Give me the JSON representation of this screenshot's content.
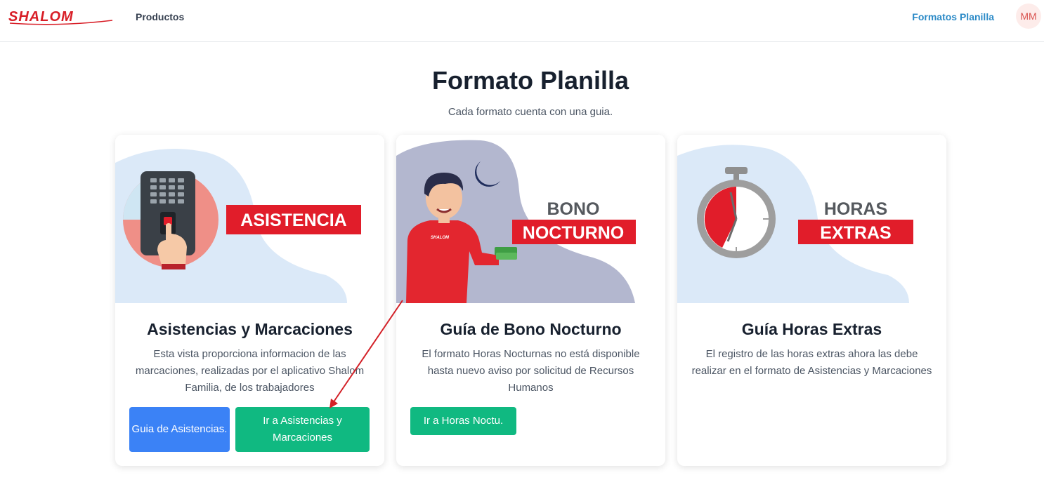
{
  "navbar": {
    "logo_text": "SHALOM",
    "products_label": "Productos",
    "formatos_label": "Formatos Planilla",
    "avatar_initials": "MM"
  },
  "header": {
    "title": "Formato Planilla",
    "subtitle": "Cada formato cuenta con una guia."
  },
  "cards": [
    {
      "image_banner": "ASISTENCIA",
      "title": "Asistencias y Marcaciones",
      "description": "Esta vista proporciona informacion de las marcaciones, realizadas por el aplicativo Shalom Familia, de los trabajadores",
      "buttons": [
        {
          "label": "Guia de Asistencias."
        },
        {
          "label": "Ir a Asistencias y Marcaciones"
        }
      ]
    },
    {
      "image_banner_line1": "BONO",
      "image_banner_line2": "NOCTURNO",
      "shirt_text": "SHALOM",
      "title": "Guía de Bono Nocturno",
      "description": "El formato Horas Nocturnas no está disponible hasta nuevo aviso por solicitud de Recursos Humanos",
      "buttons": [
        {
          "label": "Ir a Horas Noctu."
        }
      ]
    },
    {
      "image_banner_line1": "HORAS",
      "image_banner_line2": "EXTRAS",
      "title": "Guía Horas Extras",
      "description": "El registro de las horas extras ahora las debe realizar en el formato de Asistencias y Marcaciones"
    }
  ],
  "colors": {
    "brand_red": "#e11d2a",
    "link_blue": "#2b8ac7",
    "btn_blue": "#3b82f6",
    "btn_green": "#10b981"
  }
}
